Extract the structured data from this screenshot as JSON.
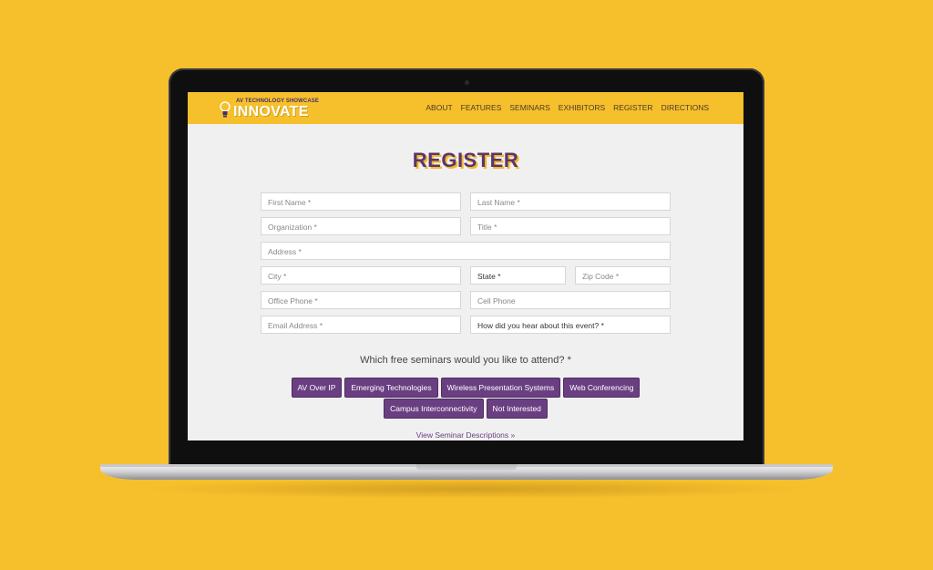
{
  "site": {
    "logo_small": "AV TECHNOLOGY SHOWCASE",
    "logo_big": "INNOVATE"
  },
  "nav": [
    "ABOUT",
    "FEATURES",
    "SEMINARS",
    "EXHIBITORS",
    "REGISTER",
    "DIRECTIONS"
  ],
  "page": {
    "title": "REGISTER"
  },
  "form": {
    "first_name": "First Name *",
    "last_name": "Last Name *",
    "organization": "Organization *",
    "title": "Title *",
    "address": "Address *",
    "city": "City *",
    "state": "State *",
    "zip": "Zip Code *",
    "office_phone": "Office Phone *",
    "cell_phone": "Cell Phone",
    "email": "Email Address *",
    "heard_about": "How did you hear about this event? *"
  },
  "seminars": {
    "question": "Which free seminars would you like to attend? *",
    "row1": [
      "AV Over IP",
      "Emerging Technologies",
      "Wireless Presentation Systems",
      "Web Conferencing"
    ],
    "row2": [
      "Campus Interconnectivity",
      "Not Interested"
    ],
    "view_link": "View Seminar Descriptions »"
  },
  "colors": {
    "background": "#f6c02c",
    "accent_purple": "#6a3f82",
    "title_purple": "#5a356f"
  },
  "icons": [
    "lightbulb-icon"
  ]
}
